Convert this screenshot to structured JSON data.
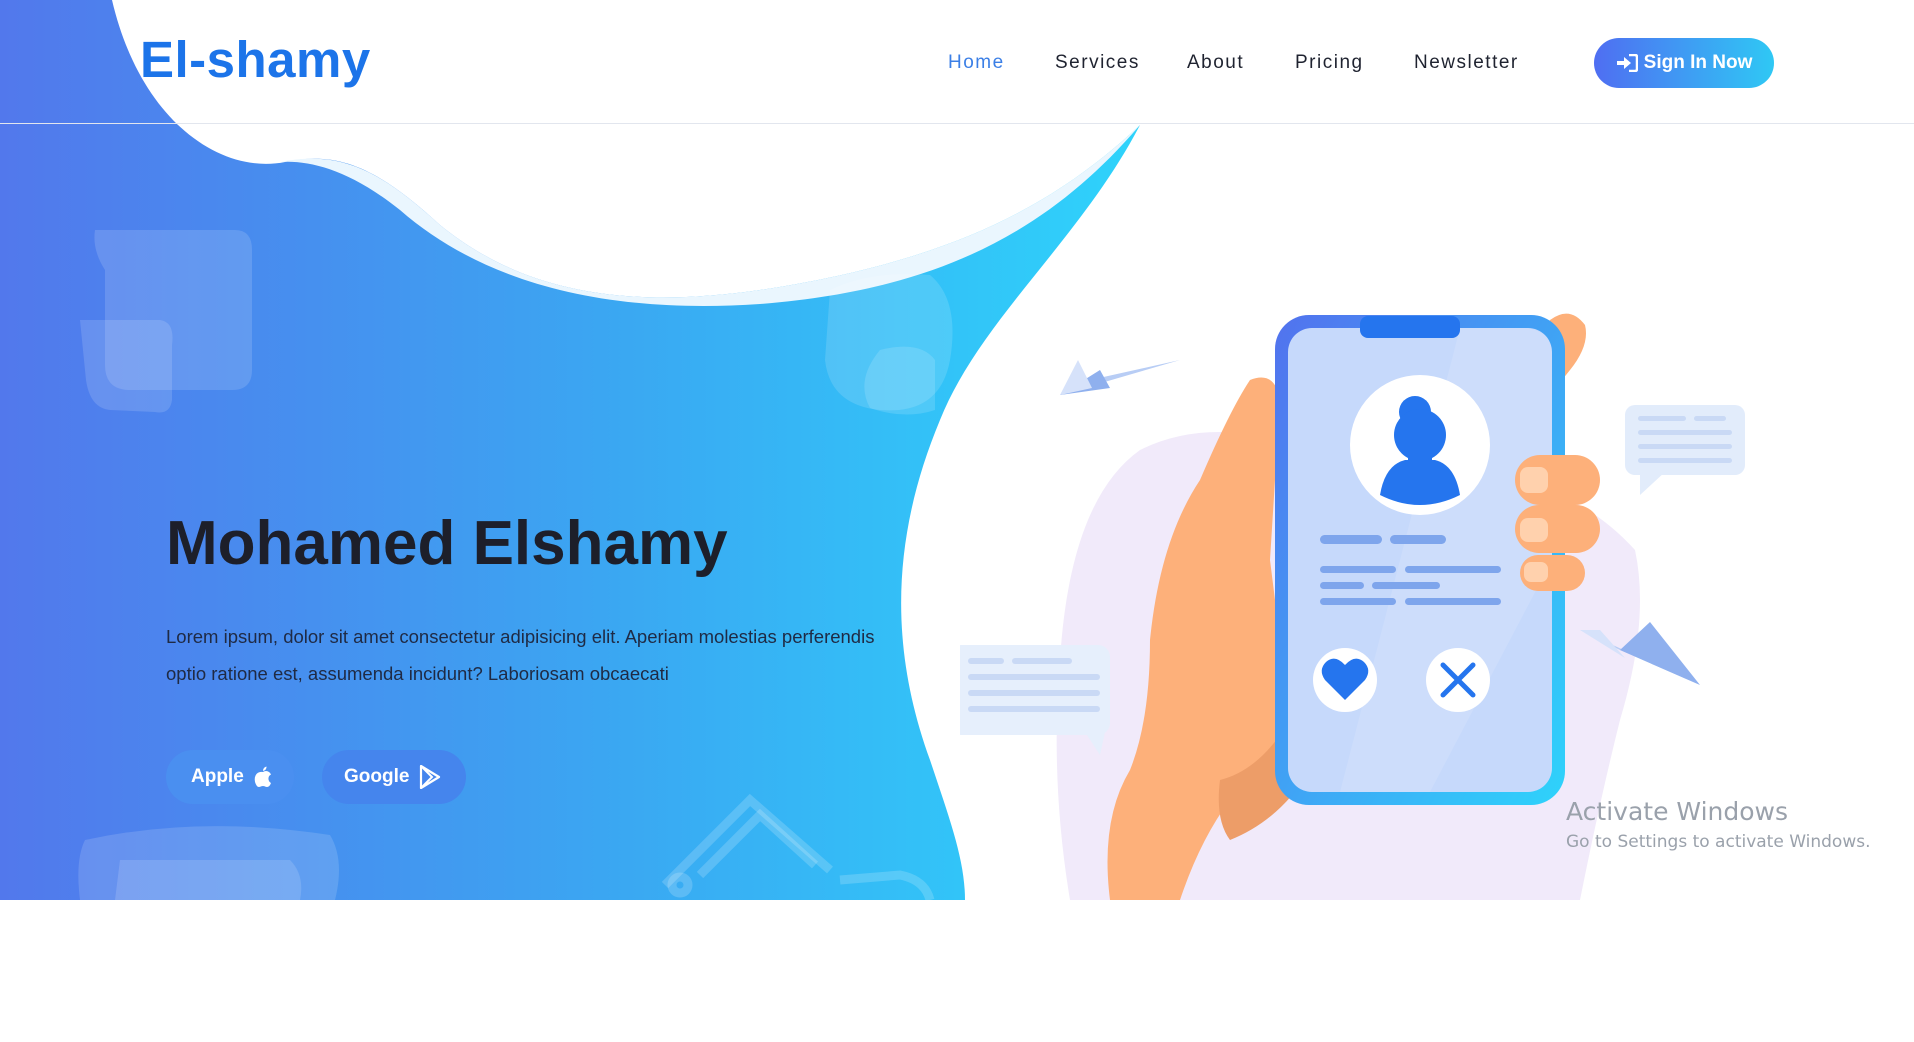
{
  "brand": {
    "logo_text": "El-shamy"
  },
  "nav": {
    "items": [
      {
        "label": "Home",
        "active": true
      },
      {
        "label": "Services",
        "active": false
      },
      {
        "label": "About",
        "active": false
      },
      {
        "label": "Pricing",
        "active": false
      },
      {
        "label": "Newsletter",
        "active": false
      }
    ],
    "signin_label": "Sign In Now"
  },
  "hero": {
    "title": "Mohamed Elshamy",
    "description_line1": "Lorem ipsum, dolor sit amet consectetur adipisicing elit. Aperiam molestias perferendis",
    "description_line2": "optio ratione est, assumenda incidunt? Laboriosam obcaecati",
    "buttons": {
      "apple_label": "Apple",
      "google_label": "Google"
    }
  },
  "watermark": {
    "title": "Activate Windows",
    "subtitle": "Go to Settings to activate Windows."
  },
  "icons": {
    "signin": "sign-in-icon",
    "apple": "apple-icon",
    "google": "google-play-icon",
    "like": "heart-icon",
    "dislike": "close-icon",
    "profile": "user-icon"
  },
  "colors": {
    "brand_blue": "#1c74e9",
    "nav_active": "#3b7fe6",
    "gradient_start": "#5278ec",
    "gradient_end": "#2ed3fb",
    "text_dark": "#1d1f2a",
    "skin": "#fdb07a",
    "phone_screen": "#c6d9fb"
  }
}
